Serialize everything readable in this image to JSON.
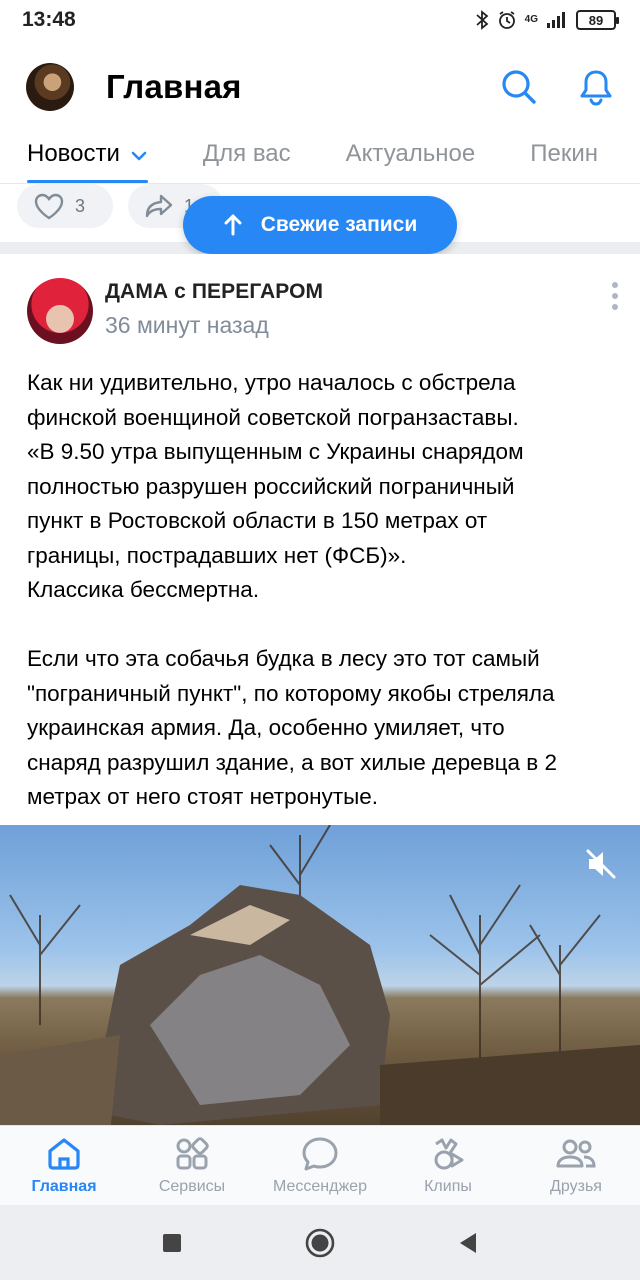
{
  "status_bar": {
    "time": "13:48",
    "signal_label": "4G",
    "battery": "89"
  },
  "header": {
    "title": "Главная"
  },
  "tabs": [
    {
      "label": "Новости",
      "active": true
    },
    {
      "label": "Для вас",
      "active": false
    },
    {
      "label": "Актуальное",
      "active": false
    },
    {
      "label": "Пекин",
      "active": false
    }
  ],
  "previous_post": {
    "likes": "3",
    "shares": "1"
  },
  "fresh_button": {
    "label": "Свежие записи"
  },
  "post": {
    "author": "ДАМА с ПЕРЕГАРОМ",
    "time": "36 минут назад",
    "paragraph1": [
      "Как ни удивительно, утро началось с обстрела",
      "финской военщиной советской погранзаставы.",
      "«В 9.50 утра выпущенным с Украины снарядом",
      "полностью разрушен российский пограничный",
      "пункт в Ростовской области в 150 метрах от",
      "границы, пострадавших нет (ФСБ)».",
      "Классика бессмертна."
    ],
    "paragraph2": [
      "Если что эта собачья будка в лесу это тот самый",
      "\"пограничный пункт\", по которому якобы стреляла",
      "украинская армия. Да, особенно умиляет, что",
      "снаряд разрушил здание, а вот хилые деревца в 2",
      "метрах от него стоят нетронутые."
    ]
  },
  "bottom_nav": [
    {
      "label": "Главная",
      "icon": "home-icon",
      "active": true
    },
    {
      "label": "Сервисы",
      "icon": "services-icon",
      "active": false
    },
    {
      "label": "Мессенджер",
      "icon": "messenger-icon",
      "active": false
    },
    {
      "label": "Клипы",
      "icon": "clips-icon",
      "active": false
    },
    {
      "label": "Друзья",
      "icon": "friends-icon",
      "active": false
    }
  ],
  "colors": {
    "accent": "#2787f5",
    "inactive": "#99a2ad",
    "feed_bg": "#ebedf0"
  }
}
